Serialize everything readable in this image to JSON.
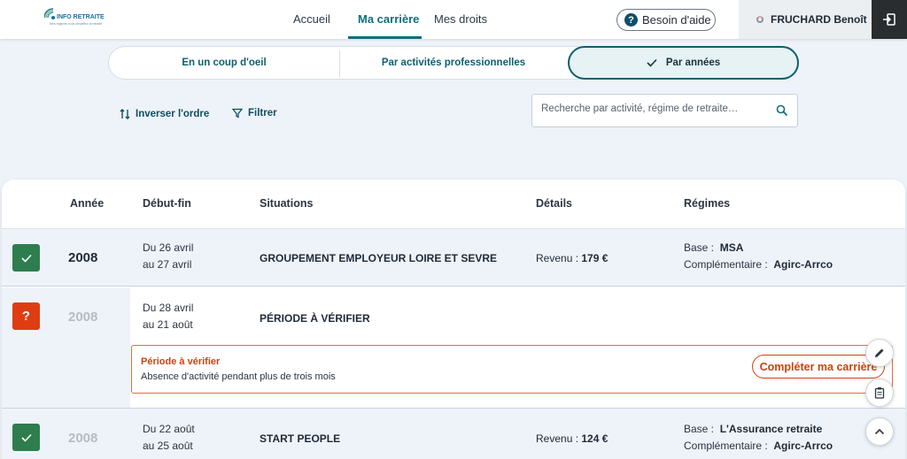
{
  "header": {
    "logo_text": "INFO RETRAITE",
    "logo_subtitle": "Mes régimes sous simplifiez la retraite",
    "nav": [
      {
        "label": "Accueil"
      },
      {
        "label": "Ma carrière"
      },
      {
        "label": "Mes droits"
      }
    ],
    "help_label": "Besoin d'aide",
    "user_name": "FRUCHARD Benoît"
  },
  "views": {
    "overview": "En un coup d'oeil",
    "by_activity": "Par activités professionnelles",
    "by_year": "Par années"
  },
  "tools": {
    "invert_label": "Inverser l'ordre",
    "filter_label": "Filtrer",
    "search_placeholder": "Recherche par activité, régime de retraite…"
  },
  "table": {
    "headers": {
      "annee": "Année",
      "debut_fin": "Début-fin",
      "situations": "Situations",
      "details": "Détails",
      "regimes": "Régimes"
    },
    "rows": [
      {
        "year": "2008",
        "date_start": "Du 26 avril",
        "date_end": "au 27 avril",
        "situation": "GROUPEMENT EMPLOYEUR LOIRE ET SEVRE",
        "detail_label": "Revenu :",
        "detail_value": "179 €",
        "base_label": "Base :",
        "base_value": "MSA",
        "comp_label": "Complémentaire :",
        "comp_value": "Agirc-Arrco"
      },
      {
        "year": "2008",
        "date_start": "Du 28 avril",
        "date_end": "au 21 août",
        "situation": "PÉRIODE À VÉRIFIER",
        "status_symbol": "?",
        "alert_title": "Période à vérifier",
        "alert_text": "Absence d'activité pendant plus de trois mois",
        "alert_button": "Compléter ma carrière"
      },
      {
        "year": "2008",
        "date_start": "Du 22 août",
        "date_end": "au 25 août",
        "situation": "START PEOPLE",
        "detail_label": "Revenu :",
        "detail_value": "124 €",
        "base_label": "Base :",
        "base_value": "L'Assurance retraite",
        "comp_label": "Complémentaire :",
        "comp_value": "Agirc-Arrco"
      }
    ]
  },
  "colors": {
    "accent": "#0f6f7a",
    "ok": "#2e7d4f",
    "warn": "#e03c12",
    "page_bg": "#eef3fa"
  },
  "icons": [
    "logo-icon",
    "help-icon",
    "user-icon",
    "logout-icon",
    "check-icon",
    "swap-vertical-icon",
    "filter-icon",
    "search-icon",
    "pencil-icon",
    "clipboard-icon",
    "chevron-up-icon"
  ]
}
